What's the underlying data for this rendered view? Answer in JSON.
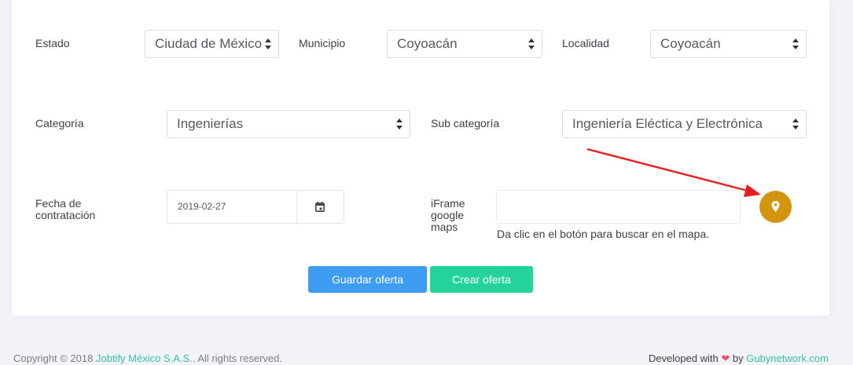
{
  "fields": {
    "estado": {
      "label": "Estado",
      "value": "Ciudad de México"
    },
    "municipio": {
      "label": "Municipio",
      "value": "Coyoacán"
    },
    "localidad": {
      "label": "Localidad",
      "value": "Coyoacán"
    },
    "categoria": {
      "label": "Categoría",
      "value": "Ingenierías"
    },
    "subcategoria": {
      "label": "Sub categoría",
      "value": "Ingeniería Eléctica y Electrónica"
    },
    "fecha": {
      "label_line1": "Fecha de",
      "label_line2": "contratación",
      "value": "2019-02-27"
    },
    "iframe": {
      "label_line1": "iFrame",
      "label_line2": "google",
      "label_line3": "maps",
      "value": "",
      "hint": "Da clic en el botón para buscar en el mapa."
    }
  },
  "buttons": {
    "save": "Guardar oferta",
    "create": "Crear oferta"
  },
  "footer": {
    "copyright_prefix": "Copyright © 2018",
    "company": "Jobtify México S.A.S.",
    "copyright_suffix": "All rights reserved.",
    "developed_prefix": "Developed with",
    "heart": "❤",
    "by": "by",
    "developer": "Gubynetwork.com"
  },
  "icons": {
    "map": "map-marker-icon",
    "calendar": "calendar-icon"
  },
  "colors": {
    "primary": "#3e9cf3",
    "success": "#24d39c",
    "map_button": "#d4950e",
    "annotation_arrow": "#e81d1d"
  }
}
